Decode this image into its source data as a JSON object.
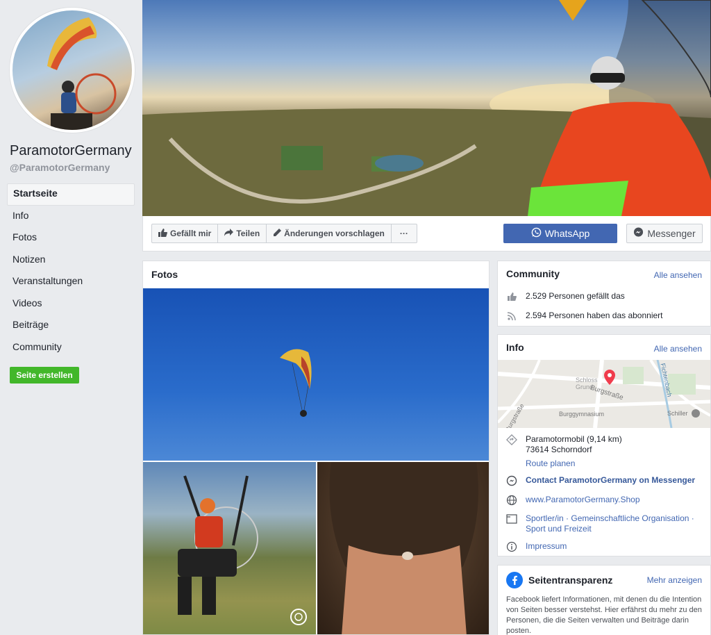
{
  "sidebar": {
    "page_name": "ParamotorGermany",
    "handle": "@ParamotorGermany",
    "nav": [
      "Startseite",
      "Info",
      "Fotos",
      "Notizen",
      "Veranstaltungen",
      "Videos",
      "Beiträge",
      "Community"
    ],
    "create_button": "Seite erstellen"
  },
  "actions": {
    "like": "Gefällt mir",
    "share": "Teilen",
    "suggest": "Änderungen vorschlagen",
    "more": "···",
    "whatsapp": "WhatsApp",
    "messenger": "Messenger"
  },
  "photos": {
    "title": "Fotos"
  },
  "community": {
    "title": "Community",
    "see_all": "Alle ansehen",
    "likes": "2.529 Personen gefällt das",
    "follows": "2.594 Personen haben das abonniert"
  },
  "info": {
    "title": "Info",
    "see_all": "Alle ansehen",
    "map_labels": [
      "Burgstraße",
      "Burggymnasium",
      "Schiller",
      "Fichtenbach",
      "Schloss Grund",
      "Burgstraße"
    ],
    "address_line1": "Paramotormobil (9,14 km)",
    "address_line2": "73614 Schorndorf",
    "route": "Route planen",
    "messenger": "Contact ParamotorGermany on Messenger",
    "website": "www.ParamotorGermany.Shop",
    "category": "Sportler/in · Gemeinschaftliche Organisation · Sport und Freizeit",
    "impressum": "Impressum"
  },
  "transparency": {
    "title": "Seitentransparenz",
    "more": "Mehr anzeigen",
    "text": "Facebook liefert Informationen, mit denen du die Intention von Seiten besser verstehst. Hier erfährst du mehr zu den Personen, die die Seiten verwalten und Beiträge darin posten."
  },
  "colors": {
    "facebook_blue": "#4267b2",
    "green_button": "#42b72a",
    "background": "#e9ebee"
  }
}
